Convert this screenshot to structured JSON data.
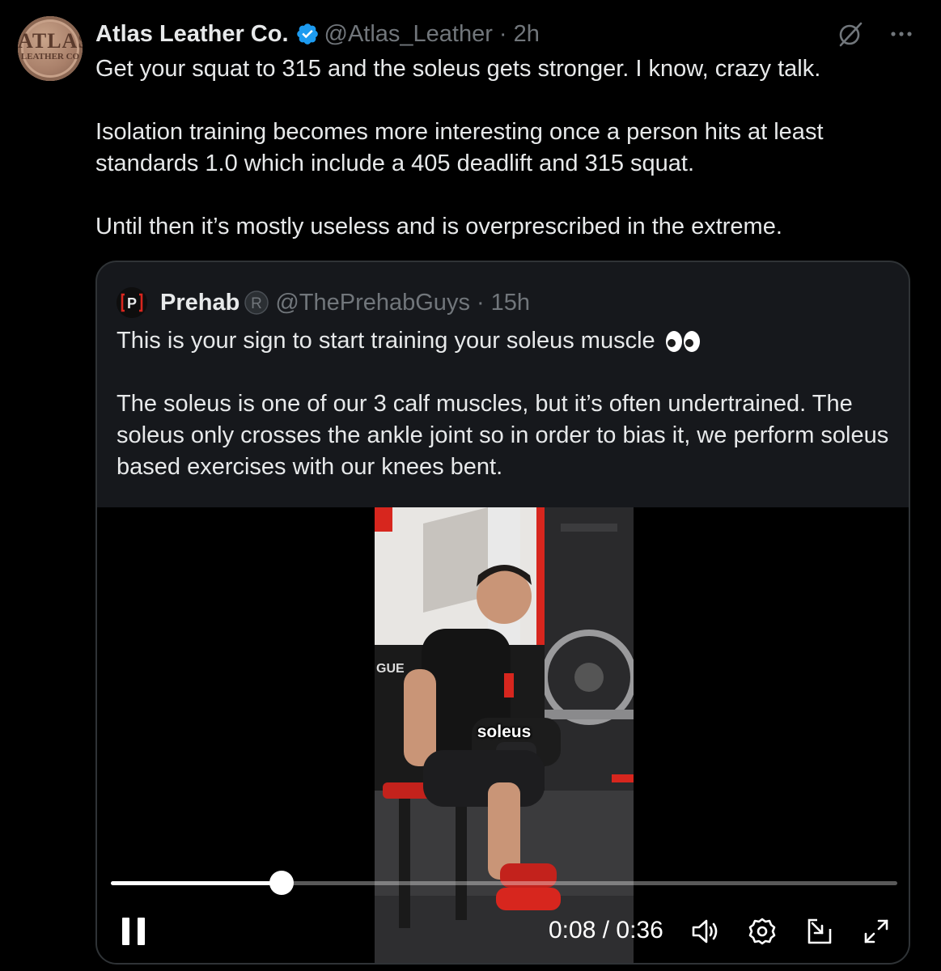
{
  "post": {
    "author": {
      "display_name": "Atlas Leather Co.",
      "handle": "@Atlas_Leather",
      "time": "2h",
      "separator": "·",
      "avatar_text_line1": "ATLAS",
      "avatar_text_line2": "LEATHER CO",
      "verified_color": "#1d9bf0"
    },
    "paragraphs": [
      "Get your squat to 315 and the soleus gets stronger. I know, crazy talk.",
      "Isolation training becomes more interesting once a person hits at least standards 1.0 which include a 405 deadlift and 315 squat.",
      "Until then it’s mostly useless and is overprescribed in the extreme."
    ],
    "icons": {
      "grok": "grok-icon",
      "more": "more-icon"
    }
  },
  "quote": {
    "author": {
      "display_name": "Prehab",
      "handle": "@ThePrehabGuys",
      "time": "15h",
      "separator": "·",
      "avatar_text": "[P]"
    },
    "paragraph1": "This is your sign to start training your soleus muscle",
    "paragraph2": "The soleus is one of our 3 calf muscles, but it’s often undertrained. The soleus only crosses the ankle joint so in order to bias it, we perform soleus based exercises with our knees bent.",
    "video": {
      "caption": "soleus",
      "frame_text": "GUE",
      "current_time": "0:08",
      "duration": "0:36",
      "time_display": "0:08 / 0:36",
      "progress_fraction": 0.217,
      "controls": [
        "pause-icon",
        "volume-icon",
        "settings-icon",
        "dock-icon",
        "fullscreen-icon"
      ]
    }
  },
  "colors": {
    "background": "#000000",
    "text": "#e7e9ea",
    "secondary_text": "#71767b",
    "card_border": "#2f3336",
    "accent_red": "#d7261e"
  }
}
